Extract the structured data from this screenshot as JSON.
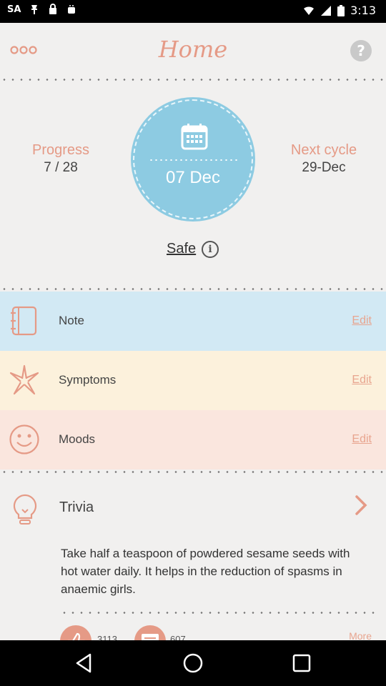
{
  "status_bar": {
    "carrier": "SA",
    "time": "3:13",
    "icons": [
      "sa-icon",
      "pin-icon",
      "wifi-icon",
      "signal-icon",
      "battery-icon"
    ]
  },
  "header": {
    "title": "Home",
    "menu_icon": "menu-dots-icon",
    "help_label": "?"
  },
  "progress": {
    "label": "Progress",
    "value": "7 / 28"
  },
  "current_date": {
    "icon": "calendar-icon",
    "value": "07 Dec"
  },
  "next_cycle": {
    "label": "Next cycle",
    "value": "29-Dec"
  },
  "safe": {
    "label": "Safe",
    "info_glyph": "i"
  },
  "rows": [
    {
      "label": "Note",
      "edit": "Edit",
      "icon": "notebook-icon",
      "bg": "#d2e9f4"
    },
    {
      "label": "Symptoms",
      "edit": "Edit",
      "icon": "asterisk-icon",
      "bg": "#fcf1dc"
    },
    {
      "label": "Moods",
      "edit": "Edit",
      "icon": "smiley-icon",
      "bg": "#fae6de"
    }
  ],
  "trivia": {
    "title": "Trivia",
    "icon": "lightbulb-icon",
    "text": "Take half a teaspoon of powdered sesame seeds with hot water daily. It helps in the reduction of spasms in anaemic girls."
  },
  "footer": {
    "likes": "3113",
    "comments": "607",
    "more": "More"
  },
  "colors": {
    "accent": "#e59a86",
    "circle": "#8dcbe2",
    "edit": "#e8a58f"
  }
}
